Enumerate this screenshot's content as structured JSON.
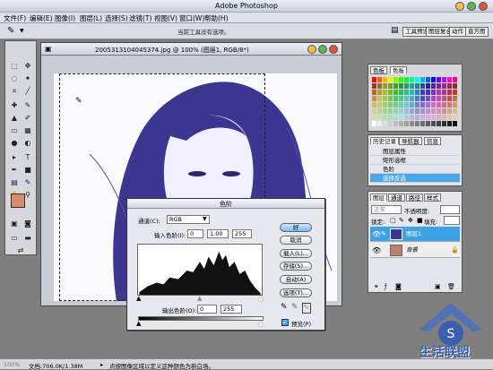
{
  "app": {
    "title": "Adobe Photoshop"
  },
  "menu": [
    "文件(F)",
    "编辑(E)",
    "图像(I)",
    "图层(L)",
    "选择(S)",
    "滤镜(T)",
    "视图(V)",
    "窗口(W)",
    "帮助(H)"
  ],
  "options": {
    "hint": "当前工具没有选项。"
  },
  "palette_tabs": [
    "工具预设",
    "图层复合",
    "动作",
    "直方图"
  ],
  "document": {
    "title": "2005313104045374.jpg @ 100% (图层1, RGB/8*)"
  },
  "levels": {
    "title": "色阶",
    "channel_label": "通道(C):",
    "channel_value": "RGB",
    "input_label": "输入色阶(I):",
    "input_values": [
      "0",
      "1.00",
      "255"
    ],
    "output_label": "输出色阶(O):",
    "output_values": [
      "0",
      "255"
    ],
    "buttons": {
      "ok": "好",
      "cancel": "取消",
      "load": "载入(L)...",
      "save": "存储(S)...",
      "auto": "自动(A)",
      "options": "选项(T)..."
    },
    "preview_label": "预览(P)",
    "preview_checked": true
  },
  "color_panel": {
    "tabs": [
      "色板",
      "色板"
    ]
  },
  "history_panel": {
    "tabs": [
      "历史记录",
      "导航器",
      "信息"
    ],
    "items": [
      "图层属性",
      "矩形选框",
      "色阶",
      "选择反选"
    ],
    "selected_index": 3
  },
  "layers_panel": {
    "tabs": [
      "图层",
      "通道",
      "路径",
      "样式"
    ],
    "blend_mode": "正常",
    "opacity_label": "不透明度:",
    "lock_label": "锁定:",
    "fill_label": "填充:",
    "layers": [
      {
        "name": "图层1",
        "selected": true
      },
      {
        "name": "背景",
        "selected": false
      }
    ]
  },
  "status": {
    "zoom": "100%",
    "doc": "文档:706.0K/1.38M",
    "hint": "点按图像区域以定义这种颜色为新白场。"
  },
  "watermark": {
    "text": "生活联盟"
  },
  "colors": {
    "accent": "#3fa2e6",
    "photo_tint": "#3b3690"
  }
}
